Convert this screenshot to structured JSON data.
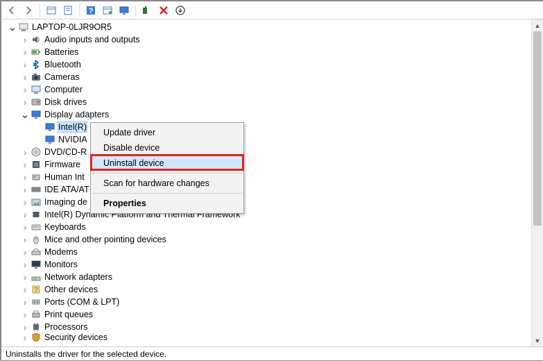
{
  "toolbar_icons": [
    "back-arrow-icon",
    "forward-arrow-icon",
    "show-hidden-icon",
    "properties-icon",
    "help-icon",
    "action-icon",
    "scan-icon",
    "add-legacy-icon",
    "remove-icon",
    "update-icon"
  ],
  "root": {
    "label": "LAPTOP-0LJR9OR5",
    "expanded": true
  },
  "categories": [
    {
      "label": "Audio inputs and outputs",
      "expanded": false,
      "icon": "audio"
    },
    {
      "label": "Batteries",
      "expanded": false,
      "icon": "battery"
    },
    {
      "label": "Bluetooth",
      "expanded": false,
      "icon": "bluetooth"
    },
    {
      "label": "Cameras",
      "expanded": false,
      "icon": "camera"
    },
    {
      "label": "Computer",
      "expanded": false,
      "icon": "computer"
    },
    {
      "label": "Disk drives",
      "expanded": false,
      "icon": "disk"
    },
    {
      "label": "Display adapters",
      "expanded": true,
      "icon": "display",
      "children": [
        {
          "label": "Intel(R)",
          "icon": "display",
          "selected": true,
          "truncated": true
        },
        {
          "label": "NVIDIA",
          "icon": "display",
          "truncated": true
        }
      ]
    },
    {
      "label": "DVD/CD-R",
      "expanded": false,
      "icon": "dvd",
      "truncated": true
    },
    {
      "label": "Firmware",
      "expanded": false,
      "icon": "firmware"
    },
    {
      "label": "Human Int",
      "expanded": false,
      "icon": "hid",
      "truncated": true
    },
    {
      "label": "IDE ATA/AT",
      "expanded": false,
      "icon": "ide",
      "truncated": true
    },
    {
      "label": "Imaging de",
      "expanded": false,
      "icon": "imaging",
      "truncated": true
    },
    {
      "label": "Intel(R) Dynamic Platform and Thermal Framework",
      "expanded": false,
      "icon": "chip"
    },
    {
      "label": "Keyboards",
      "expanded": false,
      "icon": "keyboard"
    },
    {
      "label": "Mice and other pointing devices",
      "expanded": false,
      "icon": "mouse"
    },
    {
      "label": "Modems",
      "expanded": false,
      "icon": "modem"
    },
    {
      "label": "Monitors",
      "expanded": false,
      "icon": "monitor"
    },
    {
      "label": "Network adapters",
      "expanded": false,
      "icon": "network"
    },
    {
      "label": "Other devices",
      "expanded": false,
      "icon": "other"
    },
    {
      "label": "Ports (COM & LPT)",
      "expanded": false,
      "icon": "port"
    },
    {
      "label": "Print queues",
      "expanded": false,
      "icon": "printer"
    },
    {
      "label": "Processors",
      "expanded": false,
      "icon": "cpu"
    },
    {
      "label": "Security devices",
      "expanded": false,
      "icon": "security",
      "cut": true
    }
  ],
  "context_menu": {
    "items": [
      {
        "label": "Update driver",
        "type": "item"
      },
      {
        "label": "Disable device",
        "type": "item"
      },
      {
        "label": "Uninstall device",
        "type": "item",
        "hover": true,
        "highlight": true
      },
      {
        "type": "sep"
      },
      {
        "label": "Scan for hardware changes",
        "type": "item"
      },
      {
        "type": "sep"
      },
      {
        "label": "Properties",
        "type": "item",
        "bold": true
      }
    ]
  },
  "status_text": "Uninstalls the driver for the selected device.",
  "highlight_color": "#e2231a"
}
